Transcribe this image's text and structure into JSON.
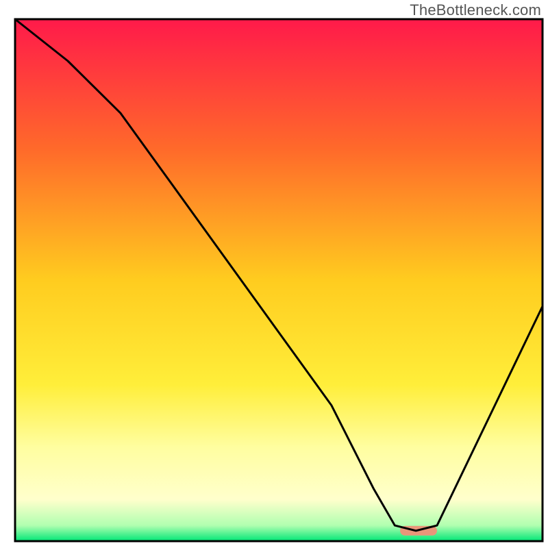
{
  "watermark": "TheBottleneck.com",
  "chart_data": {
    "type": "line",
    "title": "",
    "xlabel": "",
    "ylabel": "",
    "xlim": [
      0,
      100
    ],
    "ylim": [
      0,
      100
    ],
    "grid": false,
    "legend": false,
    "annotations": [],
    "background_gradient_stops": [
      {
        "offset": 0.0,
        "color": "#ff1a4a"
      },
      {
        "offset": 0.25,
        "color": "#ff6a2a"
      },
      {
        "offset": 0.5,
        "color": "#ffcc1f"
      },
      {
        "offset": 0.7,
        "color": "#ffee3a"
      },
      {
        "offset": 0.82,
        "color": "#fffea0"
      },
      {
        "offset": 0.92,
        "color": "#ffffcc"
      },
      {
        "offset": 0.97,
        "color": "#b0ffb0"
      },
      {
        "offset": 1.0,
        "color": "#00e676"
      }
    ],
    "series": [
      {
        "name": "bottleneck-curve",
        "color": "#000000",
        "x": [
          0,
          10,
          20,
          30,
          40,
          50,
          60,
          68,
          72,
          76,
          80,
          90,
          100
        ],
        "y": [
          100,
          92,
          82,
          68,
          54,
          40,
          26,
          10,
          3,
          2,
          3,
          24,
          45
        ]
      }
    ],
    "marker": {
      "x_start": 73,
      "x_end": 80,
      "y": 2,
      "color": "#e9967a"
    }
  }
}
